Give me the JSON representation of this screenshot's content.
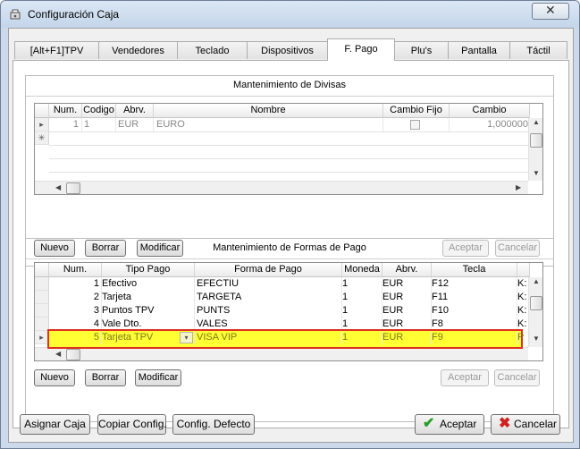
{
  "window": {
    "title": "Configuración Caja",
    "close_glyph": "✕",
    "app_icon": "cash-register-icon"
  },
  "tabs": [
    {
      "label": "[Alt+F1]TPV"
    },
    {
      "label": "Vendedores"
    },
    {
      "label": "Teclado"
    },
    {
      "label": "Dispositivos"
    },
    {
      "label": "F. Pago"
    },
    {
      "label": "Plu's"
    },
    {
      "label": "Pantalla"
    },
    {
      "label": "Táctil"
    }
  ],
  "active_tab": "F. Pago",
  "divisas": {
    "title": "Mantenimiento de Divisas",
    "columns": [
      "Num.",
      "Codigo",
      "Abrv.",
      "Nombre",
      "Cambio Fijo",
      "Cambio"
    ],
    "rows": [
      {
        "num": "1",
        "codigo": "1",
        "abrv": "EUR",
        "nombre": "EURO",
        "cambio_fijo": false,
        "cambio": "1,000000"
      }
    ],
    "new_row_marker": "✳",
    "current_row_marker": "▸",
    "buttons": {
      "nuevo": "Nuevo",
      "borrar": "Borrar",
      "modificar": "Modificar",
      "aceptar": "Aceptar",
      "cancelar": "Cancelar"
    }
  },
  "formas": {
    "title": "Mantenimiento de Formas de Pago",
    "columns": [
      "Num.",
      "Tipo Pago",
      "Forma de Pago",
      "Moneda",
      "Abrv.",
      "Tecla"
    ],
    "rows": [
      {
        "num": "1",
        "tipo": "Efectivo",
        "forma": "EFECTIU",
        "moneda": "1",
        "abrv": "EUR",
        "tecla": "F12",
        "extra": "K:"
      },
      {
        "num": "2",
        "tipo": "Tarjeta",
        "forma": "TARGETA",
        "moneda": "1",
        "abrv": "EUR",
        "tecla": "F11",
        "extra": "K:"
      },
      {
        "num": "3",
        "tipo": "Puntos TPV",
        "forma": "PUNTS",
        "moneda": "1",
        "abrv": "EUR",
        "tecla": "F10",
        "extra": "K:"
      },
      {
        "num": "4",
        "tipo": "Vale Dto.",
        "forma": "VALES",
        "moneda": "1",
        "abrv": "EUR",
        "tecla": "F8",
        "extra": "K:"
      },
      {
        "num": "5",
        "tipo": "Tarjeta TPV",
        "forma": "VISA VIP",
        "moneda": "1",
        "abrv": "EUR",
        "tecla": "F9",
        "extra": "P"
      }
    ],
    "selected_row": "5",
    "current_row_marker": "▸",
    "buttons": {
      "nuevo": "Nuevo",
      "borrar": "Borrar",
      "modificar": "Modificar",
      "aceptar": "Aceptar",
      "cancelar": "Cancelar"
    }
  },
  "footer": {
    "asignar_caja": "Asignar Caja",
    "copiar_config": "Copiar Config.",
    "config_defecto": "Config. Defecto",
    "aceptar": "Aceptar",
    "cancelar": "Cancelar"
  },
  "colors": {
    "highlight": "#ffff33",
    "highlight_border": "#e0301e",
    "accent_ok": "#2a9d2a",
    "accent_cancel": "#d02020"
  }
}
